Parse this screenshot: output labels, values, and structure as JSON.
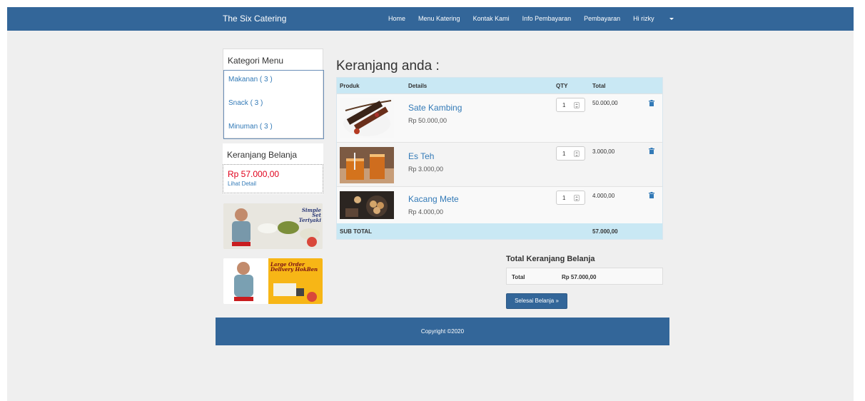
{
  "navbar": {
    "brand": "The Six Catering",
    "items": [
      "Home",
      "Menu Katering",
      "Kontak Kami",
      "Info Pembayaran",
      "Pembayaran"
    ],
    "user_menu": "Hi rizky"
  },
  "sidebar": {
    "categories_title": "Kategori Menu",
    "categories": [
      "Makanan ( 3 )",
      "Snack ( 3 )",
      "Minuman ( 3 )"
    ],
    "cart_title": "Keranjang Belanja",
    "cart_total": "Rp 57.000,00",
    "cart_link": "Lihat Detail",
    "promos": [
      {
        "headline": "Simple Set Teriyaki",
        "icon": "food-promo-image"
      },
      {
        "headline": "Large Order Delivery HokBen",
        "icon": "delivery-promo-image"
      }
    ]
  },
  "cart": {
    "title": "Keranjang anda :",
    "headers": {
      "product": "Produk",
      "details": "Details",
      "qty": "QTY",
      "total": "Total"
    },
    "items": [
      {
        "name": "Sate Kambing",
        "price": "Rp 50.000,00",
        "qty": "1",
        "total": "50.000,00",
        "icon": "sate-kambing-photo"
      },
      {
        "name": "Es Teh",
        "price": "Rp 3.000,00",
        "qty": "1",
        "total": "3.000,00",
        "icon": "es-teh-photo"
      },
      {
        "name": "Kacang Mete",
        "price": "Rp 4.000,00",
        "qty": "1",
        "total": "4.000,00",
        "icon": "kacang-mete-photo"
      }
    ],
    "subtotal_label": "SUB TOTAL",
    "subtotal_value": "57.000,00"
  },
  "summary": {
    "title": "Total Keranjang Belanja",
    "label": "Total",
    "value": "Rp 57.000,00",
    "button": "Selesai Belanja »"
  },
  "footer": {
    "text": "Copyright ©2020"
  },
  "colors": {
    "navbar": "#336699",
    "subtotal_row": "#c9e8f4",
    "price_accent": "#e0001b",
    "link": "#337ab7"
  }
}
